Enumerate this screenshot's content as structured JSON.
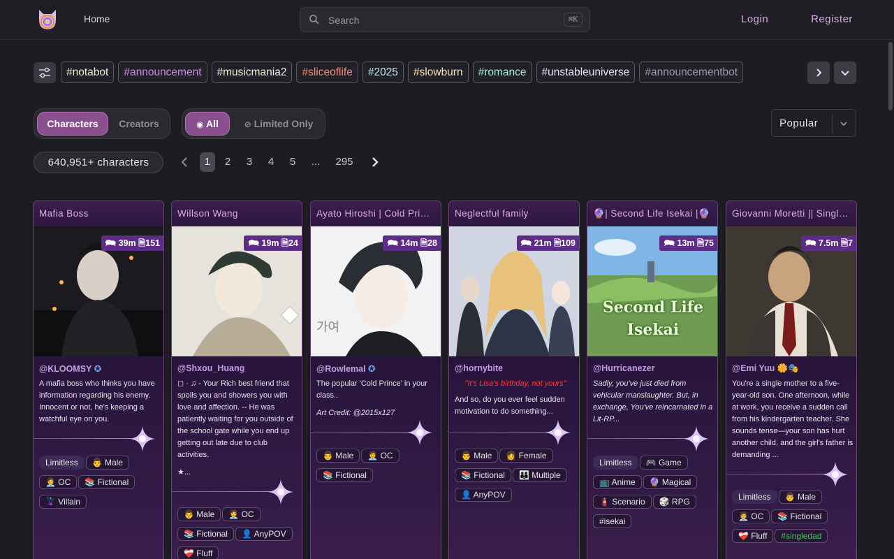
{
  "header": {
    "home": "Home",
    "search_placeholder": "Search",
    "search_shortcut": "⌘K",
    "login": "Login",
    "register": "Register"
  },
  "tags": [
    {
      "label": "#notabot",
      "color": "#f1ecd8"
    },
    {
      "label": "#announcement",
      "color": "#d28be0"
    },
    {
      "label": "#musicmania2",
      "color": "#f1ecd8"
    },
    {
      "label": "#sliceoflife",
      "color": "#f08a7a"
    },
    {
      "label": "#2025",
      "color": "#bfeaf2"
    },
    {
      "label": "#slowburn",
      "color": "#f4e3b8"
    },
    {
      "label": "#romance",
      "color": "#a8f0d0"
    },
    {
      "label": "#unstableuniverse",
      "color": "#e8e6ee"
    },
    {
      "label": "#announcementbot",
      "color": "#9c9aa4"
    }
  ],
  "segments": {
    "characters": "Characters",
    "creators": "Creators",
    "all": "All",
    "limited": "Limited Only"
  },
  "sort": "Popular",
  "count": "640,951+ characters",
  "pagination": [
    "1",
    "2",
    "3",
    "4",
    "5",
    "...",
    "295"
  ],
  "cards": [
    {
      "title": "Mafia Boss",
      "chats": "39m",
      "messages": "151",
      "creator": "@KLOOMSY",
      "description": "A mafia boss who thinks you have information regarding his enemy. Innocent or not, he's keeping a watchful eye on you.",
      "tags": [
        "Limitless",
        "👨 Male",
        "🧑‍💼 OC",
        "📚 Fictional",
        "🦹 Villain"
      ]
    },
    {
      "title": "Willson Wang",
      "chats": "19m",
      "messages": "24",
      "creator": "@Shxou_Huang",
      "description": "◻ · ♫ - Your Rich best friend that spoils you and showers you with love and affection. -- He was patiently waiting for you outside of the school gate while you end up getting out late due to club activities.",
      "description_extra": "★...",
      "tags": [
        "👨 Male",
        "🧑‍💼 OC",
        "📚 Fictional",
        "👤 AnyPOV",
        "❤️‍🩹 Fluff"
      ]
    },
    {
      "title": "Ayato Hiroshi | Cold Prince",
      "chats": "14m",
      "messages": "28",
      "creator": "@Rowlemal",
      "description": "The popular 'Cold Prince' in your class..",
      "credit": "Art Credit: @2015x127",
      "tags": [
        "👨 Male",
        "🧑‍💼 OC",
        "📚 Fictional"
      ]
    },
    {
      "title": "Neglectful family",
      "chats": "21m",
      "messages": "109",
      "creator": "@hornybite",
      "quote": "\"It's Lisa's birthday, not yours\"",
      "description": "And so, do you ever feel sudden motivation to do something...",
      "tags": [
        "👨 Male",
        "👩 Female",
        "📚 Fictional",
        "👪 Multiple",
        "👤 AnyPOV"
      ]
    },
    {
      "title": "🔮| Second Life Isekai |🔮",
      "chats": "13m",
      "messages": "75",
      "creator": "@Hurricanezer",
      "image_text": [
        "Second Life",
        "Isekai"
      ],
      "description": "Sadly, you've just died from vehicular manslaughter. But, in exchange, You've reincarnated in a Lit-RP...",
      "tags": [
        "Limitless",
        "🎮 Game",
        "📺 Anime",
        "🔮 Magical",
        "🧯 Scenario",
        "🎲 RPG",
        "#isekai"
      ]
    },
    {
      "title": "Giovanni Moretti || Single Dad",
      "chats": "7.5m",
      "messages": "7",
      "creator": "@Emi Yuu 🌼🎭",
      "description": "You're a single mother to a five-year-old son. One afternoon, while at work, you receive a sudden call from his kindergarten teacher. She sounds tense—your son has hurt another child, and the girl's father is demanding ...",
      "tags": [
        "Limitless",
        "👨 Male",
        "🧑‍💼 OC",
        "📚 Fictional",
        "❤️‍🩹 Fluff",
        "#singledad"
      ]
    }
  ]
}
